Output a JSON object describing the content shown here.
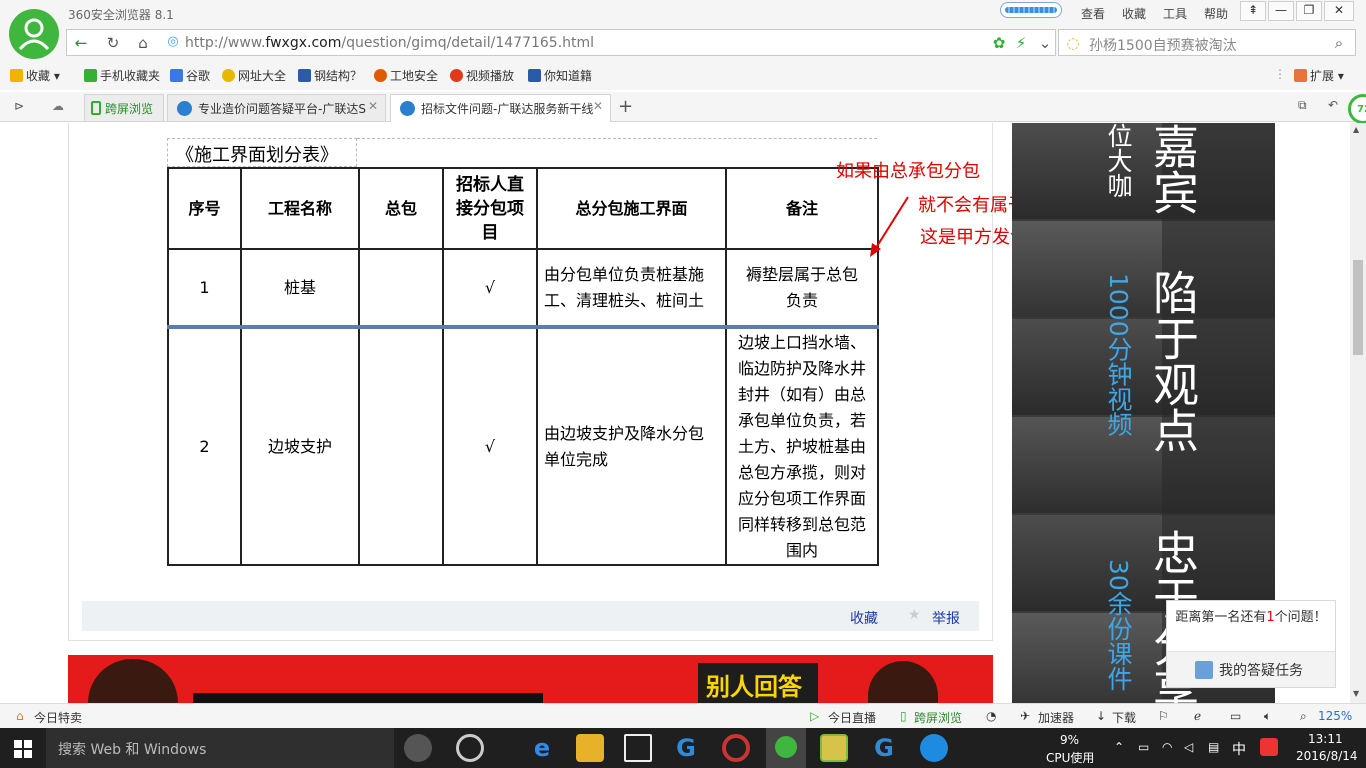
{
  "browser": {
    "app_title": "360安全浏览器 8.1",
    "menus": [
      "查看",
      "收藏",
      "工具",
      "帮助"
    ],
    "url_prefix": "http://www.",
    "url_domain": "fwxgx.com",
    "url_path": "/question/gimq/detail/1477165.html",
    "search_text": "孙杨1500自预赛被淘汰"
  },
  "favorites": {
    "collect_label": "收藏",
    "items": [
      "手机收藏夹",
      "谷歌",
      "网址大全",
      "钢结构？",
      "工地安全",
      "视频播放",
      "你知道籍"
    ],
    "extend_label": "扩展"
  },
  "tabs": {
    "items": [
      {
        "label": "跨屏浏览"
      },
      {
        "label": "专业造价问题答疑平台-广联达S"
      },
      {
        "label": "招标文件问题-广联达服务新干线"
      }
    ],
    "avatar_badge": "72"
  },
  "page": {
    "table_caption": "《施工界面划分表》",
    "headers": [
      "序号",
      "工程名称",
      "总包",
      "招标人直接分包项目",
      "总分包施工界面",
      "备注"
    ],
    "rows": [
      {
        "no": "1",
        "name": "桩基",
        "general": "",
        "direct": "√",
        "interface": "由分包单位负责桩基施工、清理桩头、桩间土",
        "remark": "褥垫层属于总包负责"
      },
      {
        "no": "2",
        "name": "边坡支护",
        "general": "",
        "direct": "√",
        "interface": "由边坡支护及降水分包单位完成",
        "remark": "边坡上口挡水墙、临边防护及降水井封井（如有）由总承包单位负责，若土方、护坡桩基由总包方承揽，则对应分包项工作界面同样转移到总包范围内"
      }
    ],
    "annotation_lines": [
      "如果由总承包分包",
      "就不会有属于总承包负责",
      "这是甲方发包"
    ],
    "action_collect": "收藏",
    "action_report": "举报",
    "banner_text": "别人回答"
  },
  "ad": {
    "col_a": "位大咖",
    "col_b": "1000分钟视频",
    "col_c": "30余份课件",
    "big_1": "嘉宾",
    "big_2": "陷于观点",
    "big_3": "忠于分享"
  },
  "task_panel": {
    "text_before": "距离第一名还有",
    "count": "1",
    "text_after": "个问题！",
    "task_label": "我的答疑任务"
  },
  "statusbar": {
    "left": "今日特卖",
    "live": "今日直播",
    "cross": "跨屏浏览",
    "accel": "加速器",
    "download": "下载",
    "zoom": "125%"
  },
  "taskbar": {
    "search_placeholder": "搜索 Web 和 Windows",
    "cpu_percent": "9%",
    "cpu_label": "CPU使用",
    "ime": "中",
    "time": "13:11",
    "date": "2016/8/14"
  },
  "colors": {
    "annotation": "#e00000",
    "link": "#1a3aa8",
    "brand_green": "#3fb73f"
  }
}
